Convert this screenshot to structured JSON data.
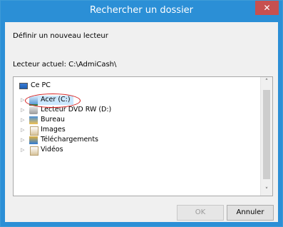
{
  "window": {
    "title": "Rechercher un dossier",
    "close_glyph": "✕"
  },
  "dialog": {
    "instruction": "Définir un nouveau lecteur",
    "current_drive": "Lecteur actuel: C:\\AdmiCash\\"
  },
  "tree": {
    "root": {
      "label": "Ce PC",
      "icon": "computer-icon"
    },
    "items": [
      {
        "label": "Acer (C:)",
        "icon": "drive-icon",
        "selected": true
      },
      {
        "label": "Lecteur DVD RW (D:)",
        "icon": "dvd-drive-icon"
      },
      {
        "label": "Bureau",
        "icon": "folder-icon"
      },
      {
        "label": "Images",
        "icon": "pictures-folder-icon"
      },
      {
        "label": "Téléchargements",
        "icon": "downloads-folder-icon"
      },
      {
        "label": "Vidéos",
        "icon": "videos-folder-icon"
      }
    ]
  },
  "scrollbar": {
    "up_glyph": "˄",
    "down_glyph": "˅"
  },
  "buttons": {
    "ok": "OK",
    "cancel": "Annuler"
  },
  "colors": {
    "titlebar": "#2b8fd6",
    "close": "#c75050",
    "highlight_ring": "#d61f1f",
    "selection": "#cce8ff"
  }
}
